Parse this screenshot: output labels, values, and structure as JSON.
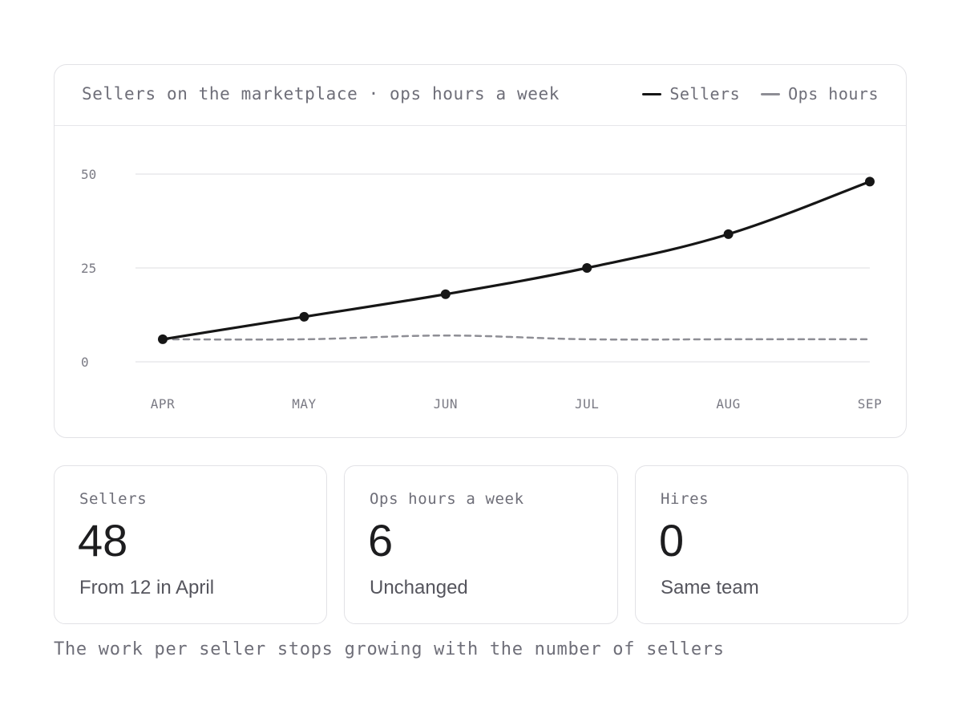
{
  "header": {
    "title": "Sellers on the marketplace · ops hours a week"
  },
  "legend": [
    {
      "label": "Sellers",
      "color": "#161616"
    },
    {
      "label": "Ops hours",
      "color": "#8e8e95"
    }
  ],
  "chart_data": {
    "type": "line",
    "title": "Sellers on the marketplace · ops hours a week",
    "xlabel": "",
    "ylabel": "",
    "categories": [
      "APR",
      "MAY",
      "JUN",
      "JUL",
      "AUG",
      "SEP"
    ],
    "yticks": [
      0,
      25,
      50
    ],
    "ylim": [
      0,
      50
    ],
    "grid": true,
    "legend_position": "top-right",
    "series": [
      {
        "name": "Sellers",
        "values": [
          6,
          12,
          18,
          25,
          34,
          48
        ],
        "color": "#161616",
        "style": "solid",
        "markers": true
      },
      {
        "name": "Ops hours",
        "values": [
          6,
          6,
          7,
          6,
          6,
          6
        ],
        "color": "#8e8e95",
        "style": "dashed",
        "markers": false
      }
    ]
  },
  "stats": [
    {
      "label": "Sellers",
      "value": "48",
      "note": "From 12 in April"
    },
    {
      "label": "Ops hours a week",
      "value": "6",
      "note": "Unchanged"
    },
    {
      "label": "Hires",
      "value": "0",
      "note": "Same team"
    }
  ],
  "footer": {
    "note": "The work per seller stops growing with the number of sellers"
  }
}
